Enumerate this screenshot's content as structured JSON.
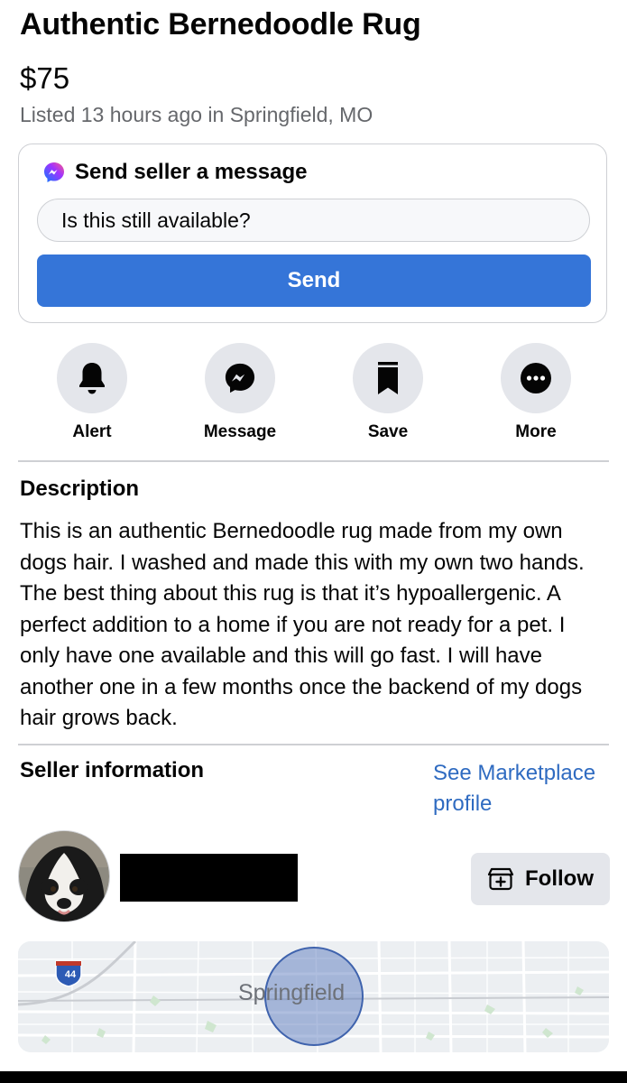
{
  "listing": {
    "title": "Authentic Bernedoodle Rug",
    "price": "$75",
    "listed": "Listed 13 hours ago in Springfield, MO"
  },
  "message_card": {
    "heading": "Send seller a message",
    "input_value": "Is this still available?",
    "send_label": "Send",
    "messenger_icon": "messenger-icon"
  },
  "actions": [
    {
      "label": "Alert",
      "icon": "bell-icon"
    },
    {
      "label": "Message",
      "icon": "messenger-icon"
    },
    {
      "label": "Save",
      "icon": "bookmark-icon"
    },
    {
      "label": "More",
      "icon": "ellipsis-icon"
    }
  ],
  "description": {
    "heading": "Description",
    "body": "This is an authentic Bernedoodle rug made from my own dogs hair. I washed and made this with my own two hands.  The best thing about this rug is that it’s hypoallergenic. A perfect addition to a home if you are not ready for a pet. I only have one available and this will go fast. I will have another one in a few months once the backend of my dogs hair grows back."
  },
  "seller": {
    "heading": "Seller information",
    "profile_link": "See Marketplace profile",
    "follow_label": "Follow",
    "name_redacted": true
  },
  "map": {
    "city_label": "Springfield",
    "highway_shield": "44"
  },
  "colors": {
    "accent": "#3575d8",
    "link": "#2f6bc1",
    "secondary_text": "#65676b",
    "button_gray": "#e4e6eb",
    "border": "#ced0d4"
  }
}
